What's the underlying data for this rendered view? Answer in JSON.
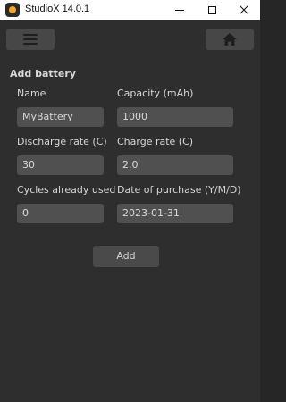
{
  "window": {
    "title": "StudioX 14.0.1"
  },
  "toolbar": {
    "menu_icon": "hamburger-menu-icon",
    "home_icon": "home-icon"
  },
  "form": {
    "title": "Add battery",
    "fields": {
      "name": {
        "label": "Name",
        "value": "MyBattery"
      },
      "capacity": {
        "label": "Capacity (mAh)",
        "value": "1000"
      },
      "discharge_rate": {
        "label": "Discharge rate (C)",
        "value": "30"
      },
      "charge_rate": {
        "label": "Charge  rate (C)",
        "value": "2.0"
      },
      "cycles": {
        "label": "Cycles already used",
        "value": "0"
      },
      "purchase_date": {
        "label": "Date of purchase (Y/M/D)",
        "value": "2023-01-31"
      }
    },
    "add_label": "Add"
  },
  "colors": {
    "background": "#2e2e2e",
    "input_background": "#505050",
    "button_background": "#474747",
    "text": "#d9d9d9",
    "app_icon_accent": "#f5a623"
  }
}
